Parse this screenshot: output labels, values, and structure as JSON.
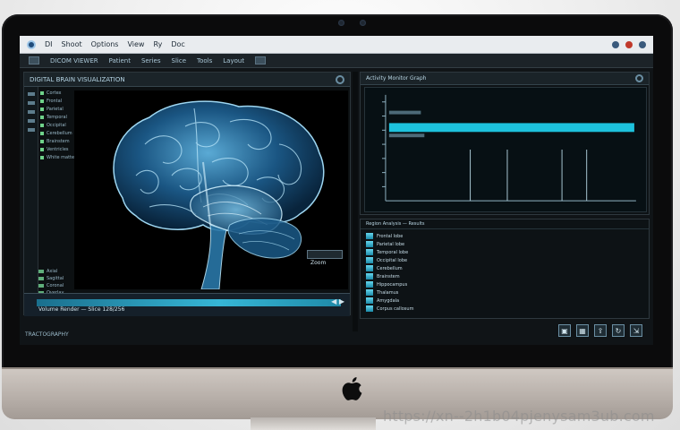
{
  "os_bar": {
    "items": [
      "DI",
      "Shoot",
      "Options",
      "View",
      "Ry",
      "Doc"
    ],
    "right_icons": [
      "search-icon",
      "record-icon",
      "close-icon"
    ]
  },
  "app_menu": {
    "items": [
      "DICOM VIEWER",
      "Patient",
      "Series",
      "Slice",
      "Tools",
      "Layout"
    ]
  },
  "left_panel": {
    "title": "DIGITAL BRAIN VISUALIZATION",
    "layers": [
      "Cortex",
      "Frontal",
      "Parietal",
      "Temporal",
      "Occipital",
      "Cerebellum",
      "Brainstem",
      "Ventricles",
      "White matter"
    ],
    "status_lines": [
      "Axial",
      "Sagittal",
      "Coronal",
      "Overlay",
      "3D"
    ],
    "timeline_label": "Volume Render — Slice 128/256",
    "viewport_control": "Zoom"
  },
  "right_top": {
    "title": "Activity Monitor Graph"
  },
  "right_bottom": {
    "title": "Region Analysis — Results",
    "rows": [
      "Frontal lobe",
      "Parietal lobe",
      "Temporal lobe",
      "Occipital lobe",
      "Cerebellum",
      "Brainstem",
      "Hippocampus",
      "Thalamus",
      "Amygdala",
      "Corpus callosum"
    ]
  },
  "bottom_label": "TRACTOGRAPHY",
  "watermark": "https://xn--2h1b04pjenysam3ub.com",
  "accent": "#2ec0db"
}
